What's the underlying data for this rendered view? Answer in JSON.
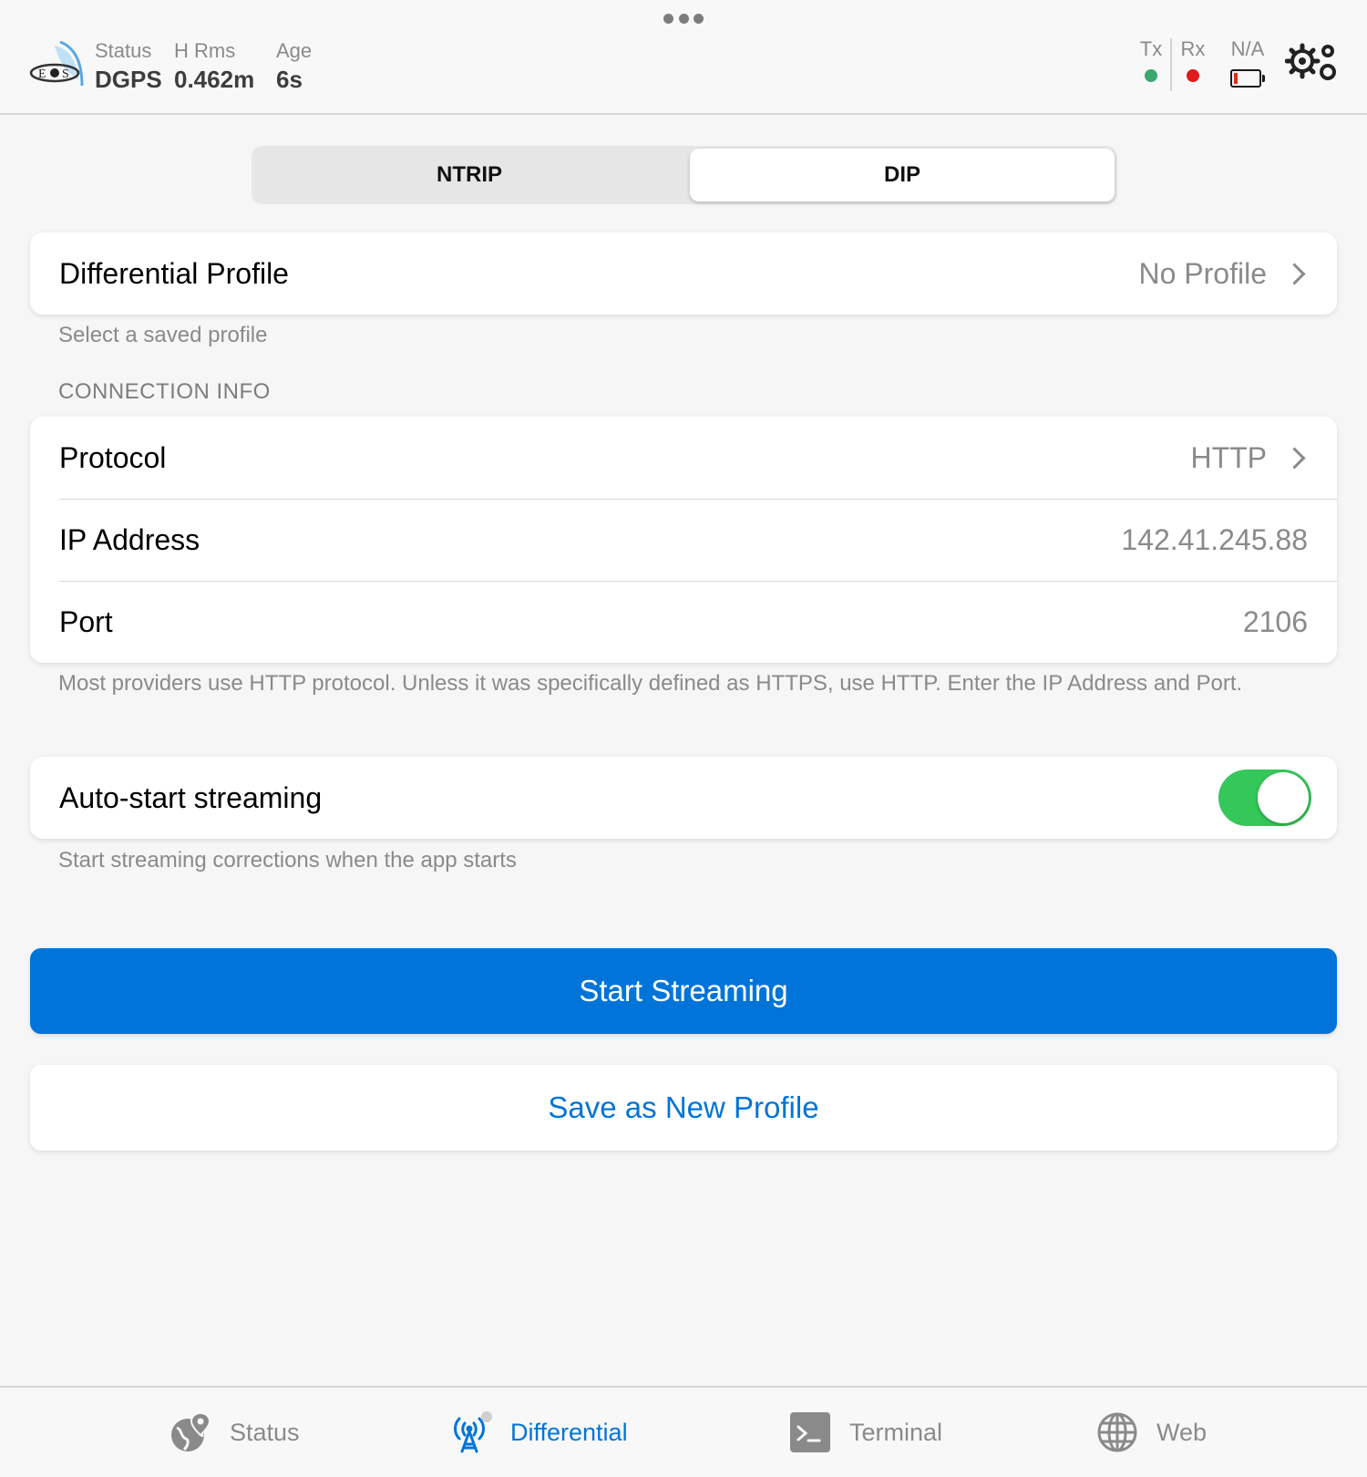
{
  "header": {
    "status_label": "Status",
    "status_value": "DGPS",
    "hrms_label": "H Rms",
    "hrms_value": "0.462m",
    "age_label": "Age",
    "age_value": "6s",
    "tx_label": "Tx",
    "rx_label": "Rx",
    "battery_label": "N/A",
    "tx_color": "#3aa96f",
    "rx_color": "#e0191b",
    "battery_level_fraction": 0.15
  },
  "segmented": {
    "options": [
      "NTRIP",
      "DIP"
    ],
    "selected": "DIP"
  },
  "profile": {
    "title": "Differential Profile",
    "value": "No Profile",
    "footnote": "Select a saved profile"
  },
  "connection": {
    "section_header": "CONNECTION INFO",
    "rows": [
      {
        "title": "Protocol",
        "value": "HTTP"
      },
      {
        "title": "IP Address",
        "value": "142.41.245.88"
      },
      {
        "title": "Port",
        "value": "2106"
      }
    ],
    "footnote": "Most providers use HTTP protocol. Unless it was specifically defined as HTTPS, use HTTP. Enter the IP Address and Port."
  },
  "autostart": {
    "title": "Auto-start streaming",
    "enabled": true,
    "footnote": "Start streaming corrections when the app starts"
  },
  "buttons": {
    "start_streaming": "Start Streaming",
    "save_profile": "Save as New Profile"
  },
  "tabs": [
    {
      "label": "Status",
      "icon": "globe-pin-icon",
      "active": false
    },
    {
      "label": "Differential",
      "icon": "antenna-tower-icon",
      "active": true
    },
    {
      "label": "Terminal",
      "icon": "terminal-icon",
      "active": false
    },
    {
      "label": "Web",
      "icon": "globe-icon",
      "active": false
    }
  ],
  "colors": {
    "accent": "#0074d9",
    "toggle_on": "#34c759",
    "background": "#f6f6f6"
  }
}
